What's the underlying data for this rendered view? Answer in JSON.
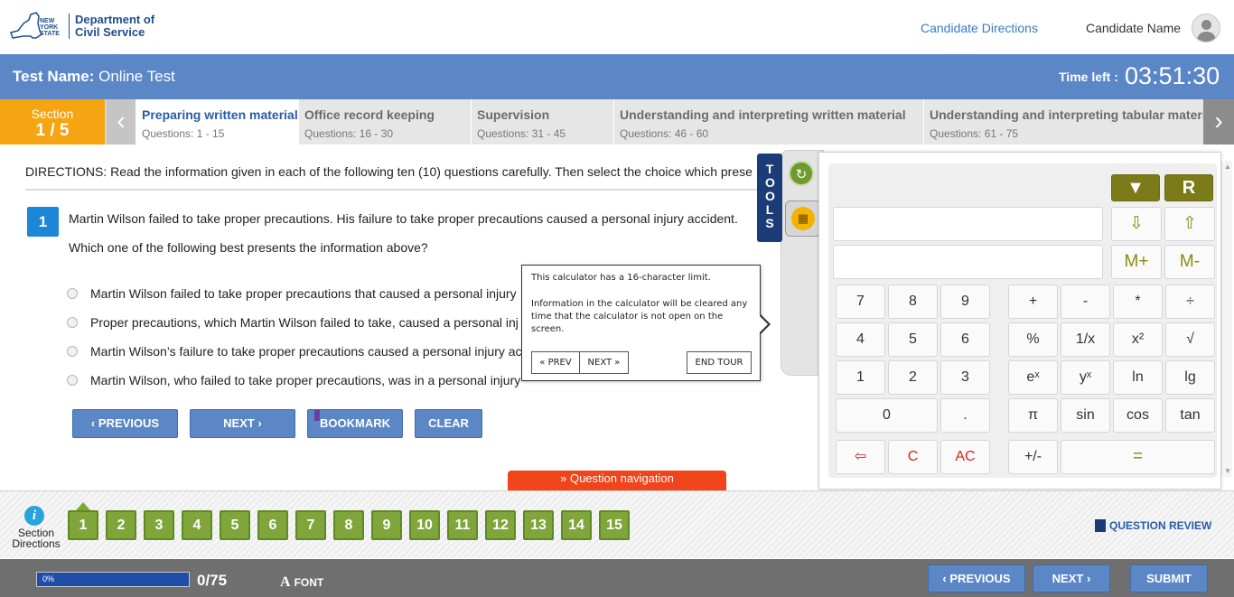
{
  "header": {
    "logo_state_text": "NEW YORK STATE",
    "logo_dept_line1": "Department of",
    "logo_dept_line2": "Civil Service",
    "candidate_directions": "Candidate Directions",
    "candidate_name": "Candidate Name"
  },
  "test_bar": {
    "test_name_label": "Test Name:",
    "test_name": "Online Test",
    "time_left_label": "Time left :",
    "time_left": "03:51:30"
  },
  "sections": {
    "label": "Section",
    "current": "1 / 5",
    "tabs": [
      {
        "title": "Preparing written material",
        "questions": "Questions: 1 - 15"
      },
      {
        "title": "Office record keeping",
        "questions": "Questions: 16 - 30"
      },
      {
        "title": "Supervision",
        "questions": "Questions: 31 - 45"
      },
      {
        "title": "Understanding and interpreting written material",
        "questions": "Questions: 46 - 60"
      },
      {
        "title": "Understanding and interpreting tabular materia",
        "questions": "Questions: 61 - 75"
      }
    ]
  },
  "question": {
    "directions": "DIRECTIONS:  Read the information given in each of the following ten (10) questions carefully.  Then select the choice which prese",
    "number": "1",
    "text": "Martin Wilson failed to take proper precautions. His failure to take proper precautions caused a personal injury accident.",
    "prompt": "Which one of the following best presents the information above?",
    "options": [
      "Martin Wilson failed to take proper precautions that caused a personal injury",
      "Proper precautions, which Martin Wilson failed to take, caused a personal inj",
      "Martin Wilson’s failure to take proper precautions caused a personal injury ac",
      "Martin Wilson, who failed to take proper precautions, was in a personal injury"
    ]
  },
  "actions": {
    "previous": "PREVIOUS",
    "next": "NEXT",
    "bookmark": "BOOKMARK",
    "clear": "CLEAR"
  },
  "tools": {
    "label": "TOOLS",
    "icons": [
      "refresh-icon",
      "calculator-icon"
    ]
  },
  "calculator": {
    "top_keys": [
      "▼",
      "R"
    ],
    "memory_keys": [
      "⇩",
      "⇧",
      "M+",
      "M-"
    ],
    "digits": [
      "7",
      "8",
      "9",
      "4",
      "5",
      "6",
      "1",
      "2",
      "3",
      "0",
      "."
    ],
    "ops_row1": [
      "+",
      "-",
      "*",
      "÷"
    ],
    "ops_row2": [
      "%",
      "1/x",
      "x²",
      "√"
    ],
    "ops_row3": [
      "eˣ",
      "yˣ",
      "ln",
      "lg"
    ],
    "ops_row4": [
      "π",
      "sin",
      "cos",
      "tan"
    ],
    "bottom_left": [
      "⇦",
      "C",
      "AC"
    ],
    "sign": "+/-",
    "equals": "="
  },
  "tour": {
    "line1": "This calculator has a 16-character limit.",
    "line2": "Information in the calculator will be cleared any time that the calculator is not open on the screen.",
    "prev": "« PREV",
    "next": "NEXT »",
    "end": "END TOUR"
  },
  "question_nav": {
    "toggle": "Question navigation",
    "section_directions": "Section Directions",
    "info_glyph": "i",
    "numbers": [
      "1",
      "2",
      "3",
      "4",
      "5",
      "6",
      "7",
      "8",
      "9",
      "10",
      "11",
      "12",
      "13",
      "14",
      "15"
    ],
    "review": "QUESTION REVIEW"
  },
  "footer": {
    "progress_percent": 0,
    "progress_label": "0%",
    "progress_count": "0/75",
    "font_label": "FONT",
    "previous": "PREVIOUS",
    "next": "NEXT",
    "submit": "SUBMIT"
  },
  "colors": {
    "primary_blue": "#5b87c6",
    "section_orange": "#f5a511",
    "question_green": "#7fa53b",
    "nav_red": "#f0441b",
    "calc_olive": "#7b7b1a"
  }
}
